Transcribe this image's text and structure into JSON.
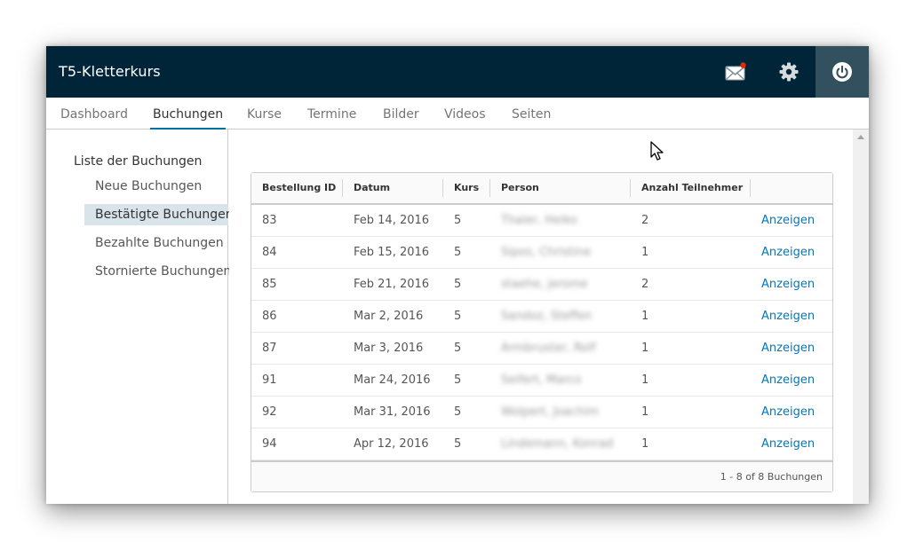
{
  "app": {
    "title": "T5-Kletterkurs"
  },
  "header": {
    "icons": [
      "mail-icon",
      "gear-icon",
      "power-icon"
    ],
    "notification_color": "#e62700",
    "background": "#002538",
    "power_background": "#33505f"
  },
  "nav": {
    "tabs": [
      {
        "label": "Dashboard"
      },
      {
        "label": "Buchungen"
      },
      {
        "label": "Kurse"
      },
      {
        "label": "Termine"
      },
      {
        "label": "Bilder"
      },
      {
        "label": "Videos"
      },
      {
        "label": "Seiten"
      }
    ],
    "active_tab": "Buchungen",
    "accent": "#0072a3"
  },
  "sidebar": {
    "heading": "Liste der Buchungen",
    "items": [
      {
        "label": "Neue Buchungen"
      },
      {
        "label": "Bestätigte Buchungen"
      },
      {
        "label": "Bezahlte Buchungen"
      },
      {
        "label": "Stornierte Buchungen"
      }
    ],
    "active_item": "Bestätigte Buchungen"
  },
  "table": {
    "columns": [
      "Bestellung ID",
      "Datum",
      "Kurs",
      "Person",
      "Anzahl Teilnehmer",
      ""
    ],
    "rows": [
      {
        "id": "83",
        "date": "Feb 14, 2016",
        "course": "5",
        "person": "Thaler, Heiko",
        "participants": "2",
        "action": "Anzeigen"
      },
      {
        "id": "84",
        "date": "Feb 15, 2016",
        "course": "5",
        "person": "Sipos, Christine",
        "participants": "1",
        "action": "Anzeigen"
      },
      {
        "id": "85",
        "date": "Feb 21, 2016",
        "course": "5",
        "person": "staehe, jerome",
        "participants": "2",
        "action": "Anzeigen"
      },
      {
        "id": "86",
        "date": "Mar 2, 2016",
        "course": "5",
        "person": "Sandoz, Steffen",
        "participants": "1",
        "action": "Anzeigen"
      },
      {
        "id": "87",
        "date": "Mar 3, 2016",
        "course": "5",
        "person": "Armbruster, Rolf",
        "participants": "1",
        "action": "Anzeigen"
      },
      {
        "id": "91",
        "date": "Mar 24, 2016",
        "course": "5",
        "person": "Seifert, Marco",
        "participants": "1",
        "action": "Anzeigen"
      },
      {
        "id": "92",
        "date": "Mar 31, 2016",
        "course": "5",
        "person": "Wolpert, Joachim",
        "participants": "1",
        "action": "Anzeigen"
      },
      {
        "id": "94",
        "date": "Apr 12, 2016",
        "course": "5",
        "person": "Lindemann, Konrad",
        "participants": "1",
        "action": "Anzeigen"
      }
    ],
    "footer": "1 - 8 of 8 Buchungen",
    "link_color": "#0079b8"
  }
}
